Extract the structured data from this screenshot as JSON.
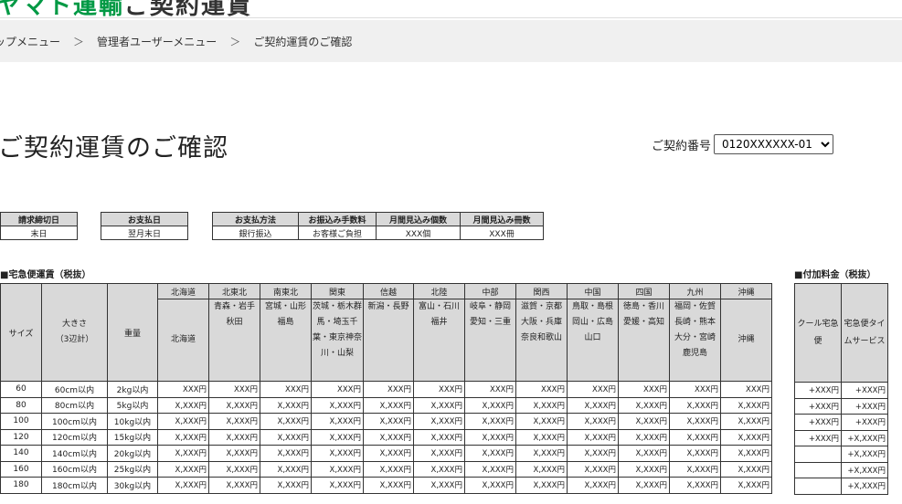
{
  "header": {
    "logo_text_green": "ヤマト運輸",
    "logo_text_dark": "ご契約運賃"
  },
  "breadcrumb": {
    "items": [
      "ップメニュー",
      "管理者ユーザーメニュー",
      "ご契約運賃のご確認"
    ],
    "separator": "＞"
  },
  "page": {
    "title": "ご契約運賃のご確認",
    "contract_label": "ご契約番号",
    "contract_value": "0120XXXXXX-01"
  },
  "billing": {
    "headers": [
      "請求締切日",
      "お支払日",
      "お支払方法",
      "お振込み手数料",
      "月間見込み個数",
      "月間見込み冊数"
    ],
    "values": [
      "末日",
      "翌月末日",
      "銀行振込",
      "お客様ご負担",
      "XXX個",
      "XXX冊"
    ]
  },
  "rates": {
    "section_label": "■宅急便運賃（税抜）",
    "col_size": "サイズ",
    "col_dim": "大きさ\n（3辺計）",
    "col_weight": "重量",
    "regions": [
      "北海道",
      "北東北",
      "南東北",
      "関東",
      "信越",
      "北陸",
      "中部",
      "関西",
      "中国",
      "四国",
      "九州",
      "沖縄"
    ],
    "prefectures": [
      "北海道",
      "青森・岩手秋田",
      "宮城・山形福島",
      "茨城・栃木群馬・埼玉千葉・東京神奈川・山梨",
      "新潟・長野",
      "富山・石川福井",
      "岐阜・静岡愛知・三重",
      "滋賀・京都大阪・兵庫奈良和歌山",
      "鳥取・島根岡山・広島山口",
      "徳島・香川愛媛・高知",
      "福岡・佐賀長崎・熊本大分・宮崎鹿児島",
      "沖縄"
    ],
    "rows": [
      {
        "size": "60",
        "dim": "60cm以内",
        "weight": "2kg以内",
        "price": "XXX円"
      },
      {
        "size": "80",
        "dim": "80cm以内",
        "weight": "5kg以内",
        "price": "X,XXX円"
      },
      {
        "size": "100",
        "dim": "100cm以内",
        "weight": "10kg以内",
        "price": "X,XXX円"
      },
      {
        "size": "120",
        "dim": "120cm以内",
        "weight": "15kg以内",
        "price": "X,XXX円"
      },
      {
        "size": "140",
        "dim": "140cm以内",
        "weight": "20kg以内",
        "price": "X,XXX円"
      },
      {
        "size": "160",
        "dim": "160cm以内",
        "weight": "25kg以内",
        "price": "X,XXX円"
      },
      {
        "size": "180",
        "dim": "180cm以内",
        "weight": "30kg以内",
        "price": "X,XXX円"
      }
    ]
  },
  "addon": {
    "section_label": "■付加料金（税抜）",
    "col_cool": "クール宅急便",
    "col_time": "宅急便タイムサービス",
    "cool_values": [
      "+XXX円",
      "+XXX円",
      "+XXX円",
      "+XXX円",
      "",
      "",
      ""
    ],
    "time_values": [
      "+XXX円",
      "+XXX円",
      "+XXX円",
      "+X,XXX円",
      "+X,XXX円",
      "+X,XXX円",
      "+X,XXX円"
    ]
  }
}
